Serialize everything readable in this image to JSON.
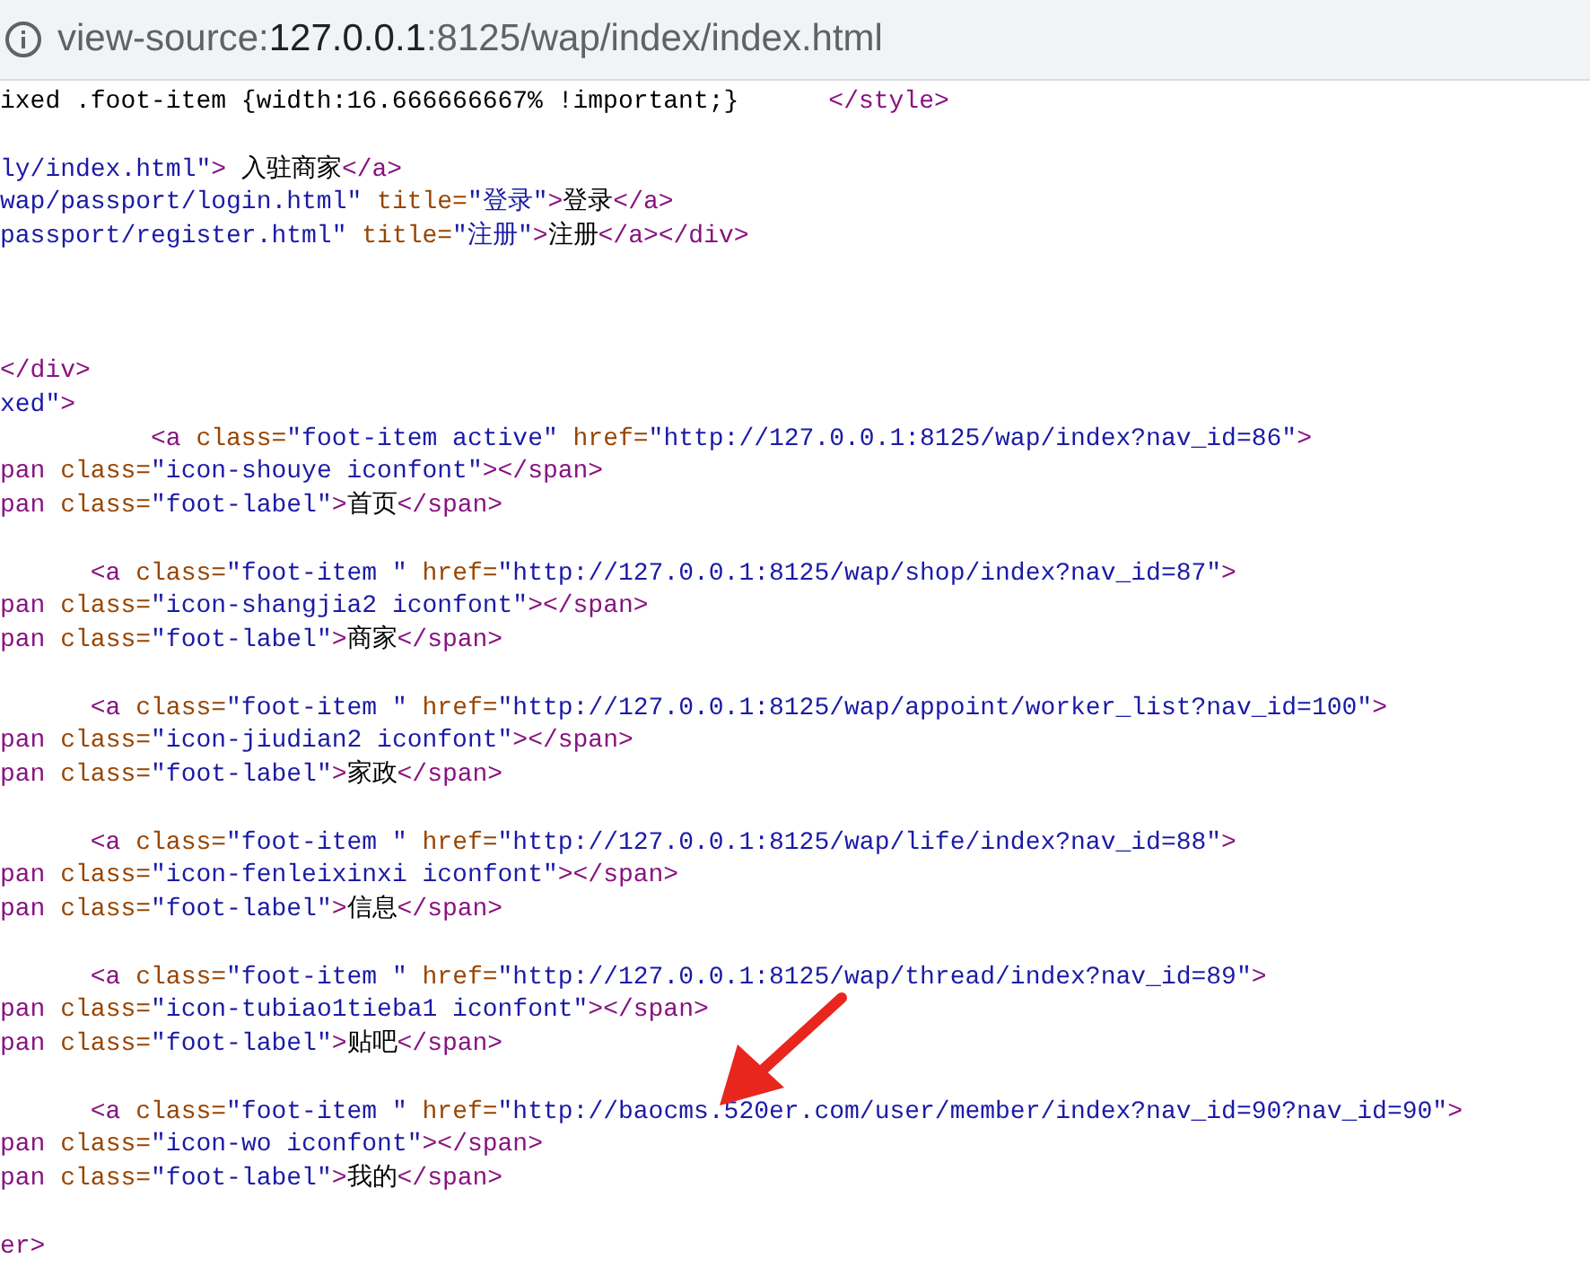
{
  "address_bar": {
    "segments": [
      {
        "kind": "scheme",
        "text": "view-source:"
      },
      {
        "kind": "host",
        "text": "127.0.0.1"
      },
      {
        "kind": "path",
        "text": ":8125/wap/index/index.html"
      }
    ]
  },
  "source_lines": [
    {
      "kind": "code",
      "tokens": [
        {
          "kind": "text",
          "text": "ixed .foot-item {width:16.666666667% !important;}"
        },
        {
          "kind": "tag",
          "text": "</style>",
          "gap_before": true
        }
      ]
    },
    {
      "kind": "blank"
    },
    {
      "kind": "code",
      "tokens": [
        {
          "kind": "value",
          "text": "ly/index.html\""
        },
        {
          "kind": "tag",
          "text": ">"
        },
        {
          "kind": "text",
          "text": " 入驻商家"
        },
        {
          "kind": "tag",
          "text": "</a>"
        }
      ]
    },
    {
      "kind": "code",
      "tokens": [
        {
          "kind": "value",
          "text": "wap/passport/login.html\""
        },
        {
          "kind": "attr",
          "text": " title="
        },
        {
          "kind": "value",
          "text": "\"登录\""
        },
        {
          "kind": "tag",
          "text": ">"
        },
        {
          "kind": "text",
          "text": "登录"
        },
        {
          "kind": "tag",
          "text": "</a>"
        }
      ]
    },
    {
      "kind": "code",
      "tokens": [
        {
          "kind": "value",
          "text": "passport/register.html\""
        },
        {
          "kind": "attr",
          "text": " title="
        },
        {
          "kind": "value",
          "text": "\"注册\""
        },
        {
          "kind": "tag",
          "text": ">"
        },
        {
          "kind": "text",
          "text": "注册"
        },
        {
          "kind": "tag",
          "text": "</a></div>"
        }
      ]
    },
    {
      "kind": "blank"
    },
    {
      "kind": "blank"
    },
    {
      "kind": "blank"
    },
    {
      "kind": "code",
      "tokens": [
        {
          "kind": "tag",
          "text": "</div>"
        }
      ]
    },
    {
      "kind": "code",
      "tokens": [
        {
          "kind": "value",
          "text": "xed\""
        },
        {
          "kind": "tag",
          "text": ">"
        }
      ]
    },
    {
      "kind": "deep",
      "tokens": [
        {
          "kind": "tag",
          "text": "<a "
        },
        {
          "kind": "attr",
          "text": "class="
        },
        {
          "kind": "value",
          "text": "\"foot-item active\""
        },
        {
          "kind": "attr",
          "text": " href="
        },
        {
          "kind": "value",
          "text": "\"http://127.0.0.1:8125/wap/index?nav_id=86\""
        },
        {
          "kind": "tag",
          "text": ">"
        }
      ]
    },
    {
      "kind": "code",
      "tokens": [
        {
          "kind": "tag",
          "text": "pan"
        },
        {
          "kind": "attr",
          "text": " class="
        },
        {
          "kind": "value",
          "text": "\"icon-shouye iconfont\""
        },
        {
          "kind": "tag",
          "text": "></span>"
        }
      ]
    },
    {
      "kind": "code",
      "tokens": [
        {
          "kind": "tag",
          "text": "pan"
        },
        {
          "kind": "attr",
          "text": " class="
        },
        {
          "kind": "value",
          "text": "\"foot-label\""
        },
        {
          "kind": "tag",
          "text": ">"
        },
        {
          "kind": "text",
          "text": "首页"
        },
        {
          "kind": "tag",
          "text": "</span>"
        }
      ]
    },
    {
      "kind": "blank"
    },
    {
      "kind": "nested",
      "tokens": [
        {
          "kind": "tag",
          "text": "<a "
        },
        {
          "kind": "attr",
          "text": "class="
        },
        {
          "kind": "value",
          "text": "\"foot-item \""
        },
        {
          "kind": "attr",
          "text": " href="
        },
        {
          "kind": "value",
          "text": "\"http://127.0.0.1:8125/wap/shop/index?nav_id=87\""
        },
        {
          "kind": "tag",
          "text": ">"
        }
      ]
    },
    {
      "kind": "code",
      "tokens": [
        {
          "kind": "tag",
          "text": "pan"
        },
        {
          "kind": "attr",
          "text": " class="
        },
        {
          "kind": "value",
          "text": "\"icon-shangjia2 iconfont\""
        },
        {
          "kind": "tag",
          "text": "></span>"
        }
      ]
    },
    {
      "kind": "code",
      "tokens": [
        {
          "kind": "tag",
          "text": "pan"
        },
        {
          "kind": "attr",
          "text": " class="
        },
        {
          "kind": "value",
          "text": "\"foot-label\""
        },
        {
          "kind": "tag",
          "text": ">"
        },
        {
          "kind": "text",
          "text": "商家"
        },
        {
          "kind": "tag",
          "text": "</span>"
        }
      ]
    },
    {
      "kind": "blank"
    },
    {
      "kind": "nested",
      "tokens": [
        {
          "kind": "tag",
          "text": "<a "
        },
        {
          "kind": "attr",
          "text": "class="
        },
        {
          "kind": "value",
          "text": "\"foot-item \""
        },
        {
          "kind": "attr",
          "text": " href="
        },
        {
          "kind": "value",
          "text": "\"http://127.0.0.1:8125/wap/appoint/worker_list?nav_id=100\""
        },
        {
          "kind": "tag",
          "text": ">"
        }
      ]
    },
    {
      "kind": "code",
      "tokens": [
        {
          "kind": "tag",
          "text": "pan"
        },
        {
          "kind": "attr",
          "text": " class="
        },
        {
          "kind": "value",
          "text": "\"icon-jiudian2 iconfont\""
        },
        {
          "kind": "tag",
          "text": "></span>"
        }
      ]
    },
    {
      "kind": "code",
      "tokens": [
        {
          "kind": "tag",
          "text": "pan"
        },
        {
          "kind": "attr",
          "text": " class="
        },
        {
          "kind": "value",
          "text": "\"foot-label\""
        },
        {
          "kind": "tag",
          "text": ">"
        },
        {
          "kind": "text",
          "text": "家政"
        },
        {
          "kind": "tag",
          "text": "</span>"
        }
      ]
    },
    {
      "kind": "blank"
    },
    {
      "kind": "nested",
      "tokens": [
        {
          "kind": "tag",
          "text": "<a "
        },
        {
          "kind": "attr",
          "text": "class="
        },
        {
          "kind": "value",
          "text": "\"foot-item \""
        },
        {
          "kind": "attr",
          "text": " href="
        },
        {
          "kind": "value",
          "text": "\"http://127.0.0.1:8125/wap/life/index?nav_id=88\""
        },
        {
          "kind": "tag",
          "text": ">"
        }
      ]
    },
    {
      "kind": "code",
      "tokens": [
        {
          "kind": "tag",
          "text": "pan"
        },
        {
          "kind": "attr",
          "text": " class="
        },
        {
          "kind": "value",
          "text": "\"icon-fenleixinxi iconfont\""
        },
        {
          "kind": "tag",
          "text": "></span>"
        }
      ]
    },
    {
      "kind": "code",
      "tokens": [
        {
          "kind": "tag",
          "text": "pan"
        },
        {
          "kind": "attr",
          "text": " class="
        },
        {
          "kind": "value",
          "text": "\"foot-label\""
        },
        {
          "kind": "tag",
          "text": ">"
        },
        {
          "kind": "text",
          "text": "信息"
        },
        {
          "kind": "tag",
          "text": "</span>"
        }
      ]
    },
    {
      "kind": "blank"
    },
    {
      "kind": "nested",
      "tokens": [
        {
          "kind": "tag",
          "text": "<a "
        },
        {
          "kind": "attr",
          "text": "class="
        },
        {
          "kind": "value",
          "text": "\"foot-item \""
        },
        {
          "kind": "attr",
          "text": " href="
        },
        {
          "kind": "value",
          "text": "\"http://127.0.0.1:8125/wap/thread/index?nav_id=89\""
        },
        {
          "kind": "tag",
          "text": ">"
        }
      ]
    },
    {
      "kind": "code",
      "tokens": [
        {
          "kind": "tag",
          "text": "pan"
        },
        {
          "kind": "attr",
          "text": " class="
        },
        {
          "kind": "value",
          "text": "\"icon-tubiao1tieba1 iconfont\""
        },
        {
          "kind": "tag",
          "text": "></span>"
        }
      ]
    },
    {
      "kind": "code",
      "tokens": [
        {
          "kind": "tag",
          "text": "pan"
        },
        {
          "kind": "attr",
          "text": " class="
        },
        {
          "kind": "value",
          "text": "\"foot-label\""
        },
        {
          "kind": "tag",
          "text": ">"
        },
        {
          "kind": "text",
          "text": "贴吧"
        },
        {
          "kind": "tag",
          "text": "</span>"
        }
      ]
    },
    {
      "kind": "blank"
    },
    {
      "kind": "nested",
      "tokens": [
        {
          "kind": "tag",
          "text": "<a "
        },
        {
          "kind": "attr",
          "text": "class="
        },
        {
          "kind": "value",
          "text": "\"foot-item \""
        },
        {
          "kind": "attr",
          "text": " href="
        },
        {
          "kind": "value",
          "text": "\"http://baocms.520er.com/user/member/index?nav_id=90?nav_id=90\""
        },
        {
          "kind": "tag",
          "text": ">"
        }
      ]
    },
    {
      "kind": "code",
      "tokens": [
        {
          "kind": "tag",
          "text": "pan"
        },
        {
          "kind": "attr",
          "text": " class="
        },
        {
          "kind": "value",
          "text": "\"icon-wo iconfont\""
        },
        {
          "kind": "tag",
          "text": "></span>"
        }
      ]
    },
    {
      "kind": "code",
      "tokens": [
        {
          "kind": "tag",
          "text": "pan"
        },
        {
          "kind": "attr",
          "text": " class="
        },
        {
          "kind": "value",
          "text": "\"foot-label\""
        },
        {
          "kind": "tag",
          "text": ">"
        },
        {
          "kind": "text",
          "text": "我的"
        },
        {
          "kind": "tag",
          "text": "</span>"
        }
      ]
    },
    {
      "kind": "blank"
    },
    {
      "kind": "code",
      "tokens": [
        {
          "kind": "tag",
          "text": "er>"
        }
      ]
    }
  ]
}
